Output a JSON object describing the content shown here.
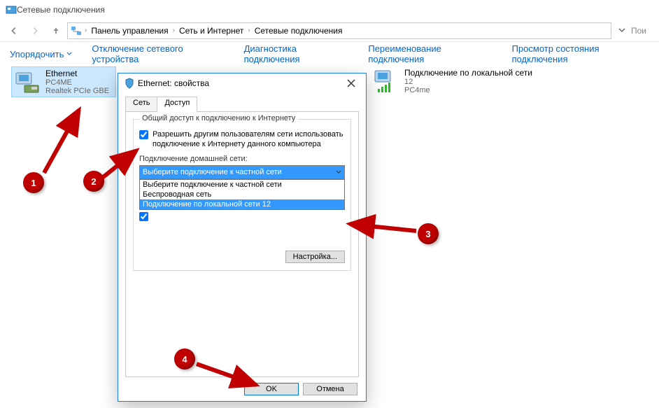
{
  "window": {
    "title": "Сетевые подключения"
  },
  "breadcrumb": {
    "a": "Панель управления",
    "b": "Сеть и Интернет",
    "c": "Сетевые подключения"
  },
  "search_placeholder": "Пои",
  "toolbar": {
    "organize": "Упорядочить",
    "disable": "Отключение сетевого устройства",
    "diagnose": "Диагностика подключения",
    "rename": "Переименование подключения",
    "status": "Просмотр состояния подключения"
  },
  "adapters": {
    "ethernet": {
      "name": "Ethernet",
      "line2": "PC4ME",
      "line3": "Realtek PCIe GBE"
    },
    "lan": {
      "name": "Подключение по локальной сети",
      "line2": "12",
      "line3": "PC4me"
    }
  },
  "dialog": {
    "title": "Ethernet: свойства",
    "tab_network": "Сеть",
    "tab_access": "Доступ",
    "group_title": "Общий доступ к подключению к Интернету",
    "chk1": "Разрешить другим пользователям сети использовать подключение к Интернету данного компьютера",
    "home_label": "Подключение домашней сети:",
    "select_value": "Выберите подключение к частной сети",
    "options": {
      "opt0": "Выберите подключение к частной сети",
      "opt1": "Беспроводная сеть",
      "opt2": "Подключение по локальной сети 12"
    },
    "setup_btn": "Настройка...",
    "ok": "OK",
    "cancel": "Отмена"
  },
  "annot": {
    "n1": "1",
    "n2": "2",
    "n3": "3",
    "n4": "4"
  }
}
